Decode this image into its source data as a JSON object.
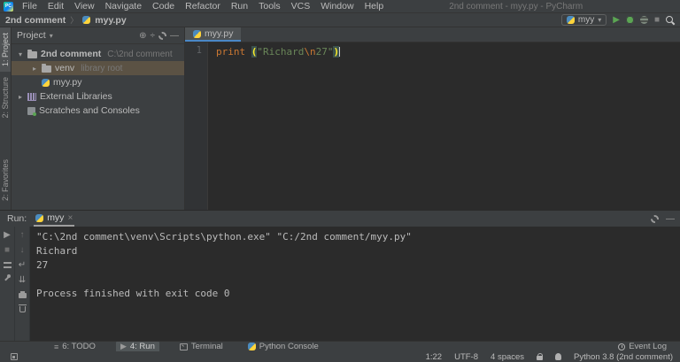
{
  "window": {
    "title": "2nd comment - myy.py - PyCharm"
  },
  "menu_bar": {
    "items": [
      "File",
      "Edit",
      "View",
      "Navigate",
      "Code",
      "Refactor",
      "Run",
      "Tools",
      "VCS",
      "Window",
      "Help"
    ]
  },
  "nav_bar": {
    "crumbs": [
      "2nd comment",
      "myy.py"
    ]
  },
  "run_toolbar": {
    "config_name": "myy"
  },
  "tool_strips": {
    "left_top": [
      {
        "label": "1: Project",
        "active": true
      },
      {
        "label": "2: Structure",
        "active": false
      }
    ],
    "left_bottom": [
      {
        "label": "2: Favorites",
        "active": false
      }
    ]
  },
  "project_panel": {
    "title": "Project",
    "header_icons": [
      "locate-icon",
      "collapse-all-icon",
      "settings-icon",
      "hide-icon"
    ],
    "tree": [
      {
        "chevron": "▾",
        "icon": "folder",
        "label": "2nd comment",
        "hint": "C:\\2nd comment",
        "bold": true,
        "indent": 0,
        "selected": false
      },
      {
        "chevron": "▸",
        "icon": "folder",
        "label": "venv",
        "hint": "library root",
        "bold": false,
        "indent": 1,
        "selected": true
      },
      {
        "chevron": "",
        "icon": "python",
        "label": "myy.py",
        "hint": "",
        "bold": false,
        "indent": 1,
        "selected": false
      },
      {
        "chevron": "▸",
        "icon": "library",
        "label": "External Libraries",
        "hint": "",
        "bold": false,
        "indent": 0,
        "selected": false
      },
      {
        "chevron": "",
        "icon": "scratch",
        "label": "Scratches and Consoles",
        "hint": "",
        "bold": false,
        "indent": 0,
        "selected": false
      }
    ]
  },
  "editor": {
    "tab_label": "myy.py",
    "line_number": "1",
    "code_tokens": [
      {
        "text": "print",
        "type": "keyword"
      },
      {
        "text": " ",
        "type": "plain"
      },
      {
        "text": "(",
        "type": "brace"
      },
      {
        "text": "\"Richard",
        "type": "string"
      },
      {
        "text": "\\n",
        "type": "escape"
      },
      {
        "text": "27\"",
        "type": "string"
      },
      {
        "text": ")",
        "type": "brace"
      }
    ]
  },
  "run_panel": {
    "label": "Run:",
    "tab_label": "myy",
    "close_glyph": "×",
    "output_lines": [
      "\"C:\\2nd comment\\venv\\Scripts\\python.exe\" \"C:/2nd comment/myy.py\"",
      "Richard",
      "27",
      "",
      "Process finished with exit code 0"
    ]
  },
  "bottom_bar": {
    "left": [
      {
        "icon": "todo-icon",
        "label": "6: TODO",
        "active": false
      },
      {
        "icon": "run-icon",
        "label": "4: Run",
        "active": true
      },
      {
        "icon": "terminal-icon",
        "label": "Terminal",
        "active": false
      },
      {
        "icon": "python-icon",
        "label": "Python Console",
        "active": false
      }
    ],
    "event_log_label": "Event Log"
  },
  "status_bar": {
    "caret_position": "1:22",
    "encoding": "UTF-8",
    "indent": "4 spaces",
    "interpreter": "Python 3.8 (2nd comment)"
  },
  "colors": {
    "accent_green": "#5BA553",
    "tab_underline": "#4A88C7",
    "selection_brown": "#5B5244",
    "string_green": "#6A8759",
    "keyword_orange": "#CC7832",
    "panel_bg": "#3C3F41",
    "editor_bg": "#2B2B2B"
  }
}
